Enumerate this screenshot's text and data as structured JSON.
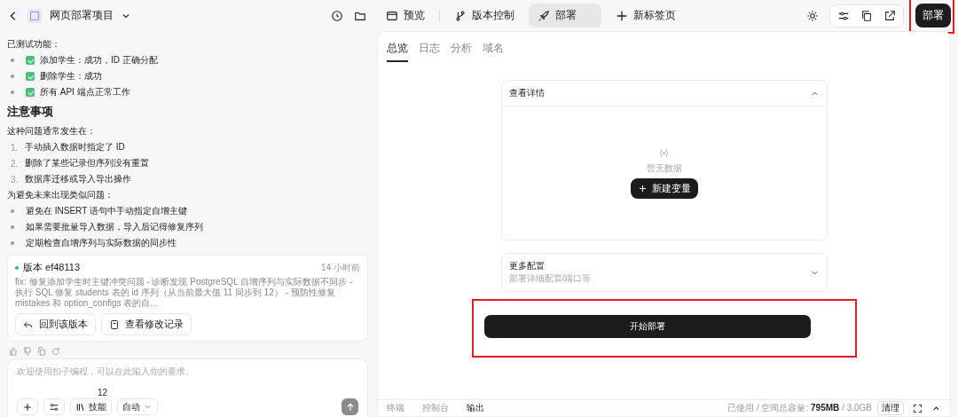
{
  "project": {
    "title": "网页部署项目"
  },
  "tabs": [
    {
      "label": "预览",
      "selected": false
    },
    {
      "label": "版本控制",
      "selected": false
    },
    {
      "label": "部署",
      "selected": true
    },
    {
      "label": "新标签页",
      "selected": false
    }
  ],
  "deploy_button": "部署",
  "chat": {
    "tested_label": "已测试功能：",
    "tested_items": [
      {
        "text": "添加学生：成功，ID 正确分配",
        "checked": true
      },
      {
        "text": "删除学生：成功",
        "checked": true
      },
      {
        "text": "所有 API 端点正常工作",
        "checked": true
      }
    ],
    "heading": "注意事项",
    "causes_intro": "这种问题通常发生在：",
    "causes": [
      {
        "num": "1.",
        "text": "手动插入数据时指定了 ID"
      },
      {
        "num": "2.",
        "text": "删除了某些记录但序列没有重置"
      },
      {
        "num": "3.",
        "text": "数据库迁移或导入导出操作"
      }
    ],
    "avoid_intro": "为避免未来出现类似问题：",
    "avoid": [
      "避免在 INSERT 语句中手动指定自增主键",
      "如果需要批量导入数据，导入后记得修复序列",
      "定期检查自增序列与实际数据的同步性"
    ],
    "version": {
      "label": "版本 ef48113",
      "time": "14 小时前",
      "message": "fix: 修复添加学生时主键冲突问题 - 诊断发现 PostgreSQL 自增序列与实际数据不同步 - 执行 SQL 修复 students 表的 id 序列（从当前最大值 11 同步到 12） - 预防性修复 mistakes 和 option_configs 表的自...",
      "buttons": [
        "回到该版本",
        "查看修改记录"
      ]
    },
    "input": {
      "placeholder": "欢迎使用扣子编程，可以在此输入你的要求。"
    },
    "skills": {
      "label": "技能",
      "count": "12"
    },
    "mode": "自动"
  },
  "panel": {
    "subtabs": [
      {
        "label": "总览",
        "selected": true
      },
      {
        "label": "日志",
        "selected": false
      },
      {
        "label": "分析",
        "selected": false
      },
      {
        "label": "域名",
        "selected": false
      }
    ],
    "details": {
      "title": "查看详情",
      "expanded": true,
      "empty_text": "暂无数据",
      "add_button": "新建变量"
    },
    "more": {
      "title": "更多配置",
      "subtitle": "部署详细配置/端口等",
      "expanded": false
    },
    "start_button": "开始部署",
    "bottom_tabs": [
      {
        "label": "终端",
        "selected": false
      },
      {
        "label": "控制台",
        "selected": false
      },
      {
        "label": "输出",
        "selected": true
      }
    ],
    "storage": "已使用 / 空间总容量: **795MB** / 3.0GB",
    "clean_button": "清理"
  }
}
